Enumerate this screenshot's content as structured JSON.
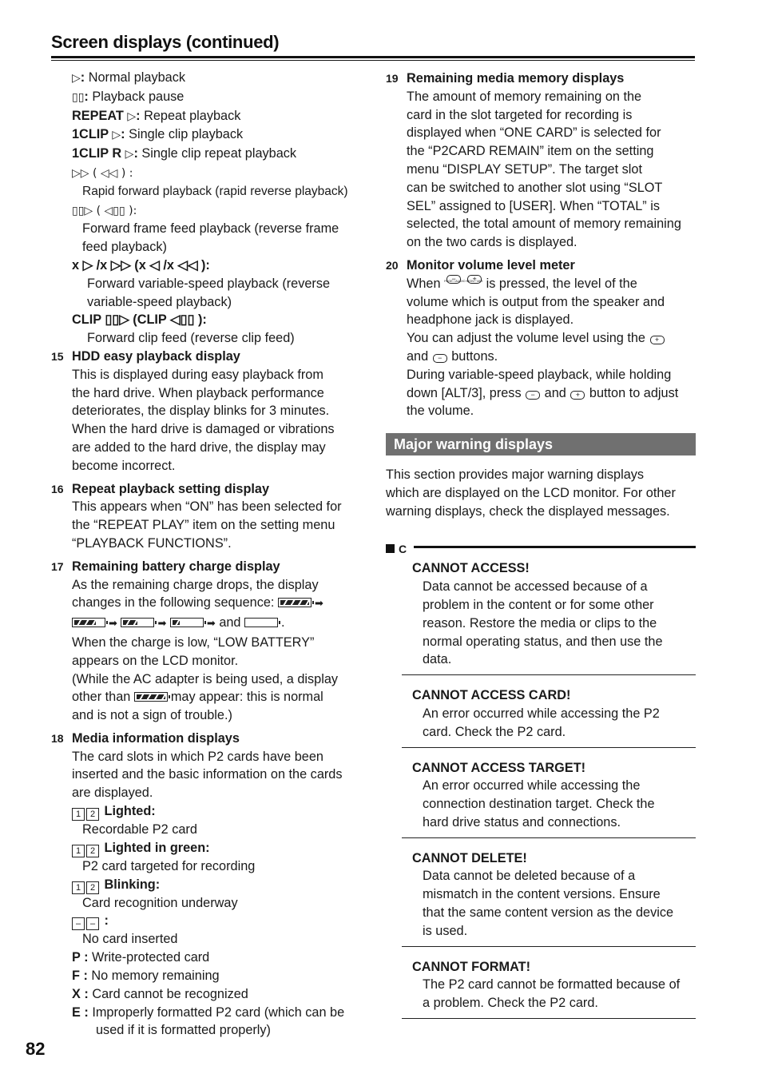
{
  "header": {
    "title": "Screen displays (continued)"
  },
  "page_number": "82",
  "left": {
    "playback_modes": [
      {
        "sym": "▷",
        "bold": "",
        "text": ": Normal playback"
      },
      {
        "sym": "▯▯",
        "bold": "",
        "text": ": Playback pause"
      },
      {
        "sym": "▷",
        "bold": "REPEAT",
        "text": ": Repeat playback"
      },
      {
        "sym": "▷",
        "bold": "1CLIP",
        "text": ": Single clip playback"
      },
      {
        "sym": "▷",
        "bold": "1CLIP R",
        "text": ": Single clip repeat playback"
      }
    ],
    "rapid": {
      "label": "▷▷ ( ◁◁ ) :",
      "desc": "Rapid forward playback (rapid reverse playback)"
    },
    "frame": {
      "label": "▯▯▷ ( ◁▯▯ ):",
      "desc1": "Forward frame feed playback (reverse frame",
      "desc2": "feed playback)"
    },
    "variable": {
      "label": "x ▷ /x ▷▷ (x ◁ /x ◁◁ ):",
      "desc1": "Forward variable-speed playback (reverse",
      "desc2": "variable-speed playback)"
    },
    "clip": {
      "label": "CLIP ▯▯▷ (CLIP ◁▯▯ ):",
      "desc": "Forward clip feed (reverse clip feed)"
    },
    "s15": {
      "num": "15",
      "title": "HDD easy playback display",
      "lines": [
        "This is displayed during easy playback from",
        "the hard drive. When playback performance",
        "deteriorates, the display blinks for 3 minutes.",
        "When the hard drive is damaged or vibrations",
        "are added to the hard drive, the display may",
        "become incorrect."
      ]
    },
    "s16": {
      "num": "16",
      "title": "Repeat playback setting display",
      "lines": [
        "This appears when “ON” has been selected for",
        "the “REPEAT PLAY” item on the setting menu",
        "“PLAYBACK FUNCTIONS”."
      ]
    },
    "s17": {
      "num": "17",
      "title": "Remaining battery charge display",
      "line1": "As the remaining charge drops, the display",
      "line2": "changes in the following sequence:",
      "and": "and",
      "battery_levels": [
        1.0,
        0.75,
        0.5,
        0.25,
        0.0
      ],
      "lines": [
        "When the charge is low, “LOW BATTERY”",
        "appears on the LCD monitor.",
        "(While the AC adapter is being used, a display"
      ],
      "other_than": "other than",
      "may_appear": "may appear: this is normal",
      "last": "and is not a sign of trouble.)"
    },
    "s18": {
      "num": "18",
      "title": "Media information displays",
      "lines": [
        "The card slots in which P2 cards have been",
        "inserted and the basic information on the cards",
        "are displayed."
      ],
      "slot_states": [
        {
          "boxes": [
            "1",
            "2"
          ],
          "label": "Lighted:",
          "desc": "Recordable P2 card"
        },
        {
          "boxes": [
            "1",
            "2"
          ],
          "label": "Lighted in green:",
          "desc": "P2 card targeted for recording"
        },
        {
          "boxes": [
            "1",
            "2"
          ],
          "label": "Blinking:",
          "desc": "Card recognition underway"
        },
        {
          "boxes": [
            "–",
            "–"
          ],
          "label": ":",
          "desc": "No card inserted"
        }
      ],
      "codes": [
        {
          "code": "P",
          "desc": "Write-protected card"
        },
        {
          "code": "F",
          "desc": "No memory remaining"
        },
        {
          "code": "X",
          "desc": "Card cannot be recognized"
        },
        {
          "code": "E",
          "desc": "Improperly formatted P2 card (which can be",
          "desc2": "used if it is formatted properly)"
        }
      ]
    }
  },
  "right": {
    "s19": {
      "num": "19",
      "title": "Remaining media memory displays",
      "lines": [
        "The amount of memory remaining on the",
        "card in the slot targeted for recording is",
        "displayed when “ONE CARD” is selected for",
        "the “P2CARD REMAIN” item on the setting",
        "menu “DISPLAY SETUP”. The target slot",
        "can be switched to another slot using “SLOT",
        "SEL” assigned to [USER]. When “TOTAL” is",
        "selected, the total amount of memory remaining",
        "on the two cards is displayed."
      ]
    },
    "s20": {
      "num": "20",
      "title": "Monitor volume level meter",
      "when": "When",
      "pressed": "is pressed, the level of the",
      "button_caption": "PAGE / AUDIO MON / VAR",
      "lines": [
        "volume which is output from the speaker and",
        "headphone jack is displayed."
      ],
      "adjust": "You can adjust the volume level using the",
      "and": "and",
      "buttons": "buttons.",
      "during": "During variable-speed playback, while holding",
      "down": "down [ALT/3], press",
      "button_adjust": "button to adjust",
      "the_volume": "the volume."
    },
    "banner": "Major warning displays",
    "intro": [
      "This section provides major warning displays",
      "which are displayed on the LCD monitor. For other",
      "warning displays, check the displayed messages."
    ],
    "category": "C",
    "warnings": [
      {
        "title": "CANNOT ACCESS!",
        "lines": [
          "Data cannot be accessed because of a",
          "problem in the content or for some other",
          "reason. Restore the media or clips to the",
          "normal operating status, and then use the",
          "data."
        ]
      },
      {
        "title": "CANNOT ACCESS CARD!",
        "lines": [
          "An error occurred while accessing the P2",
          "card. Check the P2 card."
        ]
      },
      {
        "title": "CANNOT ACCESS TARGET!",
        "lines": [
          "An error occurred while accessing the",
          "connection destination target. Check the",
          "hard drive status and connections."
        ]
      },
      {
        "title": "CANNOT DELETE!",
        "lines": [
          "Data cannot be deleted because of a",
          "mismatch in the content versions. Ensure",
          "that the same content version as the device",
          "is used."
        ]
      },
      {
        "title": "CANNOT FORMAT!",
        "lines": [
          "The P2 card cannot be formatted because of",
          "a problem. Check the P2 card."
        ]
      }
    ]
  }
}
